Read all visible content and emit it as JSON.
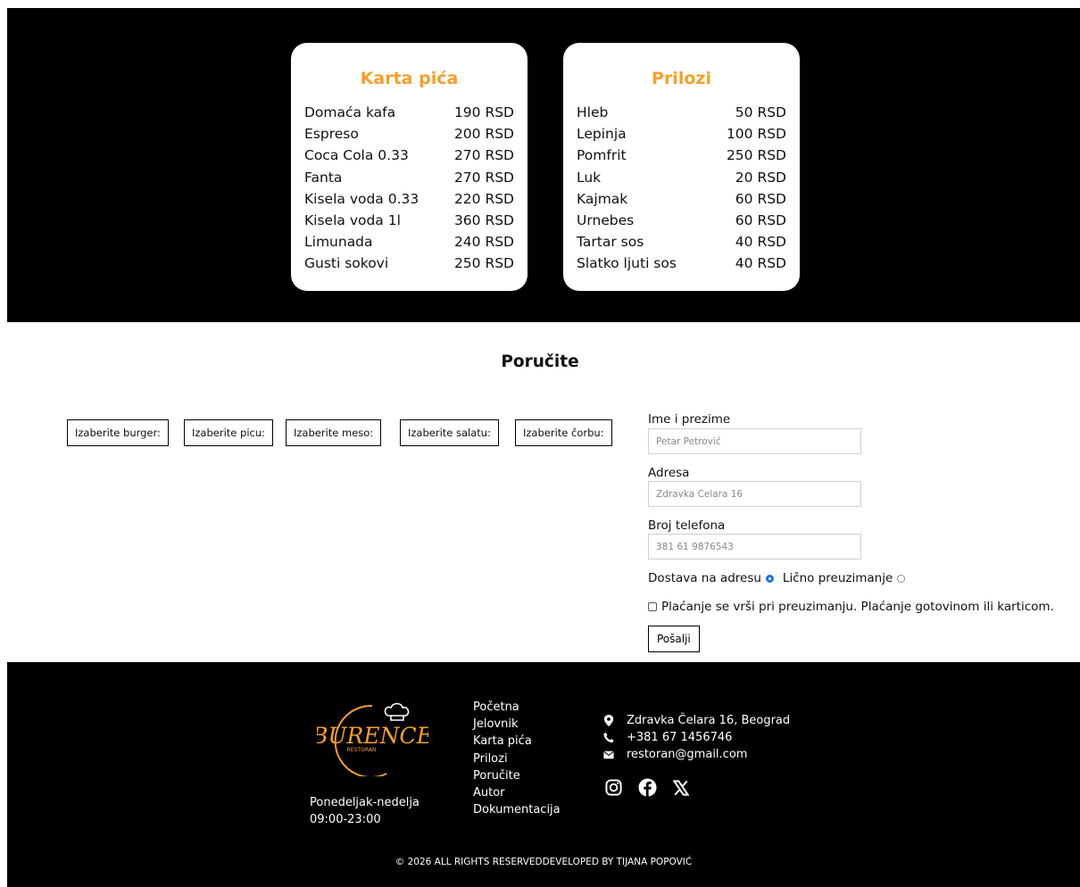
{
  "menu": {
    "drinks": {
      "title": "Karta pića",
      "items": [
        {
          "name": "Domaća kafa",
          "price": "190 RSD"
        },
        {
          "name": "Espreso",
          "price": "200 RSD"
        },
        {
          "name": "Coca Cola 0.33",
          "price": "270 RSD"
        },
        {
          "name": "Fanta",
          "price": "270 RSD"
        },
        {
          "name": "Kisela voda 0.33",
          "price": "220 RSD"
        },
        {
          "name": "Kisela voda 1l",
          "price": "360 RSD"
        },
        {
          "name": "Limunada",
          "price": "240 RSD"
        },
        {
          "name": "Gusti sokovi",
          "price": "250 RSD"
        }
      ]
    },
    "sides": {
      "title": "Prilozi",
      "items": [
        {
          "name": "Hleb",
          "price": "50 RSD"
        },
        {
          "name": "Lepinja",
          "price": "100 RSD"
        },
        {
          "name": "Pomfrit",
          "price": "250 RSD"
        },
        {
          "name": "Luk",
          "price": "20 RSD"
        },
        {
          "name": "Kajmak",
          "price": "60 RSD"
        },
        {
          "name": "Urnebes",
          "price": "60 RSD"
        },
        {
          "name": "Tartar sos",
          "price": "40 RSD"
        },
        {
          "name": "Slatko ljuti sos",
          "price": "40 RSD"
        }
      ]
    }
  },
  "order": {
    "title": "Poručite",
    "selectors": [
      "Izaberite burger:",
      "Izaberite picu:",
      "Izaberite meso:",
      "Izaberite salatu:",
      "Izaberite čorbu:"
    ],
    "form": {
      "name_label": "Ime i prezime",
      "name_placeholder": "Petar Petrović",
      "address_label": "Adresa",
      "address_placeholder": "Zdravka Čelara 16",
      "phone_label": "Broj telefona",
      "phone_placeholder": "381 61 9876543",
      "delivery_label": "Dostava na adresu",
      "pickup_label": "Lično preuzimanje",
      "payment_note": "Plaćanje se vrši pri preuzimanju. Plaćanje gotovinom ili karticom.",
      "submit_label": "Pošalji"
    }
  },
  "footer": {
    "logo_text": "BURENCE",
    "logo_subtext": "RESTORAN",
    "hours_days": "Ponedeljak-nedelja",
    "hours_time": "09:00-23:00",
    "nav": [
      "Početna",
      "Jelovnik",
      "Karta pića",
      "Prilozi",
      "Poručite",
      "Autor",
      "Dokumentacija"
    ],
    "address": "Zdravka Čelara 16, Beograd",
    "phone": "+381 67 1456746",
    "email": "restoran@gmail.com",
    "social_icons": [
      "instagram-icon",
      "facebook-icon",
      "x-icon"
    ],
    "copyright": "© 2026 ALL RIGHTS RESERVEDDEVELOPED BY TIJANA POPOVIĆ"
  },
  "colors": {
    "accent": "#f5a028",
    "background_dark": "#000000",
    "radio_selected": "#1a73e8"
  }
}
